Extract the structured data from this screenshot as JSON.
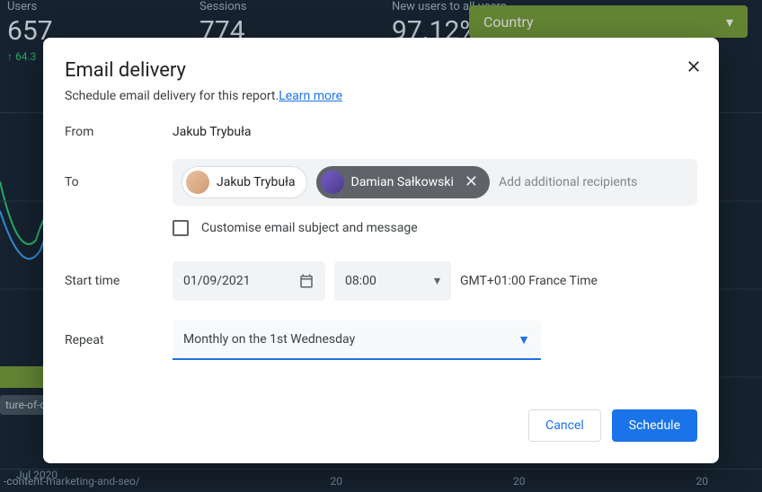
{
  "background": {
    "cards": [
      {
        "label": "Users",
        "value": "657",
        "delta": "↑ 64.3"
      },
      {
        "label": "Sessions",
        "value": "774",
        "delta": ""
      },
      {
        "label": "New users to all users",
        "value": "97.12%",
        "delta": ""
      }
    ],
    "country": {
      "label": "Country"
    },
    "x_label": "Jul 2020",
    "pill": "ture-of-c",
    "bottom_url": "-content-marketing-and-seo/",
    "bottom_nums": [
      "20",
      "20",
      "20"
    ]
  },
  "modal": {
    "title": "Email delivery",
    "subtitle": "Schedule email delivery for this report.",
    "learn_more": "Learn more",
    "from_label": "From",
    "from_value": "Jakub Trybuła",
    "to_label": "To",
    "recipients": [
      {
        "name": "Jakub Trybuła",
        "removable": false,
        "avatar_bg": "linear-gradient(135deg,#e8c29e,#d19b72)"
      },
      {
        "name": "Damian Sałkowski",
        "removable": true,
        "avatar_bg": "linear-gradient(135deg,#7a5cc7,#4a3a8a)"
      }
    ],
    "add_placeholder": "Add additional recipients",
    "customise_label": "Customise email subject and message",
    "start_label": "Start time",
    "date_value": "01/09/2021",
    "time_value": "08:00",
    "timezone": "GMT+01:00 France Time",
    "repeat_label": "Repeat",
    "repeat_value": "Monthly on the 1st Wednesday",
    "cancel": "Cancel",
    "schedule": "Schedule"
  }
}
